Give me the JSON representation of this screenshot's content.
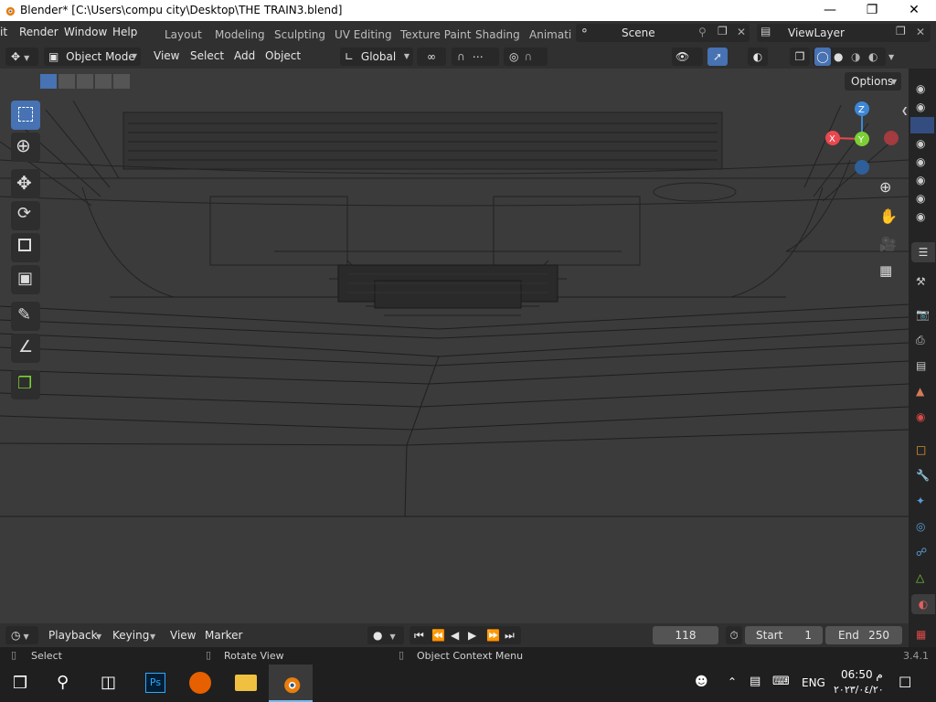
{
  "window": {
    "title": "Blender* [C:\\Users\\compu city\\Desktop\\THE TRAIN3.blend]"
  },
  "menu": [
    "it",
    "Render",
    "Window",
    "Help"
  ],
  "workspaces": [
    "Layout",
    "Modeling",
    "Sculpting",
    "UV Editing",
    "Texture Paint",
    "Shading",
    "Animati"
  ],
  "scene": {
    "name": "Scene"
  },
  "view_layer": {
    "name": "ViewLayer"
  },
  "header": {
    "mode": "Object Mode",
    "items": [
      "View",
      "Select",
      "Add",
      "Object"
    ],
    "transform": "Global"
  },
  "viewport": {
    "options_label": "Options",
    "gizmo": {
      "x": "X",
      "y": "Y",
      "z": "Z"
    }
  },
  "timeline": {
    "menus": [
      "Playback",
      "Keying",
      "View",
      "Marker"
    ],
    "current_frame": "118",
    "start_label": "Start",
    "start": "1",
    "end_label": "End",
    "end": "250"
  },
  "status": {
    "select": "Select",
    "rotate": "Rotate View",
    "context": "Object Context Menu",
    "version": "3.4.1"
  },
  "taskbar": {
    "lang": "ENG",
    "time": "06:50 م",
    "date": "٢٠٢٣/٠٤/٢٠"
  },
  "colors": {
    "accent": "#4772b3",
    "x_axis": "#e8484f",
    "y_axis": "#7ccf35",
    "z_axis": "#3e87d6"
  }
}
